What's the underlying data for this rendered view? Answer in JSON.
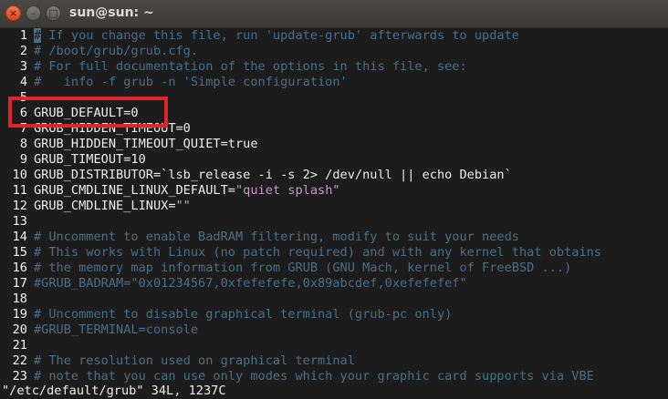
{
  "window": {
    "title": "sun@sun: ~"
  },
  "buttons": {
    "close": "×",
    "minimize": "–",
    "maximize": "□"
  },
  "lines": [
    {
      "n": "1",
      "segs": [
        {
          "c": "cursor",
          "t": "#"
        },
        {
          "c": "comment",
          "t": " If you change this file, run 'update-grub' afterwards to update"
        }
      ]
    },
    {
      "n": "2",
      "segs": [
        {
          "c": "comment",
          "t": "# /boot/grub/grub.cfg."
        }
      ]
    },
    {
      "n": "3",
      "segs": [
        {
          "c": "comment",
          "t": "# For full documentation of the options in this file, see:"
        }
      ]
    },
    {
      "n": "4",
      "segs": [
        {
          "c": "comment",
          "t": "#   info -f grub -n 'Simple configuration'"
        }
      ]
    },
    {
      "n": "5",
      "segs": []
    },
    {
      "n": "6",
      "segs": [
        {
          "c": "plain",
          "t": "GRUB_DEFAULT=0"
        }
      ]
    },
    {
      "n": "7",
      "segs": [
        {
          "c": "plain",
          "t": "GRUB_HIDDEN_TIMEOUT=0"
        }
      ]
    },
    {
      "n": "8",
      "segs": [
        {
          "c": "plain",
          "t": "GRUB_HIDDEN_TIMEOUT_QUIET=true"
        }
      ]
    },
    {
      "n": "9",
      "segs": [
        {
          "c": "plain",
          "t": "GRUB_TIMEOUT=10"
        }
      ]
    },
    {
      "n": "10",
      "segs": [
        {
          "c": "plain",
          "t": "GRUB_DISTRIBUTOR=`lsb_release -i -s 2> /dev/null || echo Debian`"
        }
      ]
    },
    {
      "n": "11",
      "segs": [
        {
          "c": "plain",
          "t": "GRUB_CMDLINE_LINUX_DEFAULT="
        },
        {
          "c": "str",
          "t": "\"quiet splash\""
        }
      ]
    },
    {
      "n": "12",
      "segs": [
        {
          "c": "plain",
          "t": "GRUB_CMDLINE_LINUX="
        },
        {
          "c": "str",
          "t": "\"\""
        }
      ]
    },
    {
      "n": "13",
      "segs": []
    },
    {
      "n": "14",
      "segs": [
        {
          "c": "comment",
          "t": "# Uncomment to enable BadRAM filtering, modify to suit your needs"
        }
      ]
    },
    {
      "n": "15",
      "segs": [
        {
          "c": "comment",
          "t": "# This works with Linux (no patch required) and with any kernel that obtains"
        }
      ]
    },
    {
      "n": "16",
      "segs": [
        {
          "c": "comment",
          "t": "# the memory map information from GRUB (GNU Mach, kernel of FreeBSD ...)"
        }
      ]
    },
    {
      "n": "17",
      "segs": [
        {
          "c": "comment",
          "t": "#GRUB_BADRAM=\"0x01234567,0xfefefefe,0x89abcdef,0xefefefef\""
        }
      ]
    },
    {
      "n": "18",
      "segs": []
    },
    {
      "n": "19",
      "segs": [
        {
          "c": "comment",
          "t": "# Uncomment to disable graphical terminal (grub-pc only)"
        }
      ]
    },
    {
      "n": "20",
      "segs": [
        {
          "c": "comment",
          "t": "#GRUB_TERMINAL=console"
        }
      ]
    },
    {
      "n": "21",
      "segs": []
    },
    {
      "n": "22",
      "segs": [
        {
          "c": "comment",
          "t": "# The resolution used on graphical terminal"
        }
      ]
    },
    {
      "n": "23",
      "segs": [
        {
          "c": "comment",
          "t": "# note that you can use only modes which your graphic card supports via VBE"
        }
      ]
    }
  ],
  "status": {
    "text": "\"/etc/default/grub\" 34L, 1237C"
  },
  "colors": {
    "comment": "#4a6f86",
    "string": "#c896c8",
    "highlight": "#e0242d"
  }
}
